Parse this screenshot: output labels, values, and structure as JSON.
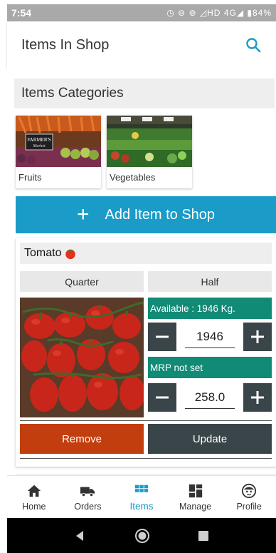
{
  "status_bar": {
    "time": "7:54",
    "icons_text": "◷ ⊖ ⊚ ◿HD 4G◢ ▮84%"
  },
  "app_bar": {
    "title": "Items In Shop"
  },
  "categories": {
    "header": "Items Categories",
    "items": [
      {
        "label": "Fruits",
        "icon": "farmers-market-photo"
      },
      {
        "label": "Vegetables",
        "icon": "vegetable-aisle-photo"
      }
    ]
  },
  "add_item": {
    "label": "Add Item to Shop"
  },
  "item": {
    "title": "Tomato",
    "tabs": [
      "Quarter",
      "Half"
    ],
    "available_text": "Available : 1946 Kg.",
    "quantity_value": "1946",
    "mrp_text": "MRP not set",
    "price_value": "258.0",
    "remove_label": "Remove",
    "update_label": "Update"
  },
  "bottom_nav": [
    {
      "label": "Home",
      "icon": "home-icon"
    },
    {
      "label": "Orders",
      "icon": "truck-icon"
    },
    {
      "label": "Items",
      "icon": "grid-icon",
      "active": true
    },
    {
      "label": "Manage",
      "icon": "dashboard-icon"
    },
    {
      "label": "Profile",
      "icon": "face-icon"
    }
  ],
  "colors": {
    "accent": "#1b9bc8",
    "teal": "#118a76",
    "dark": "#3a4549",
    "remove": "#c23e0e"
  }
}
